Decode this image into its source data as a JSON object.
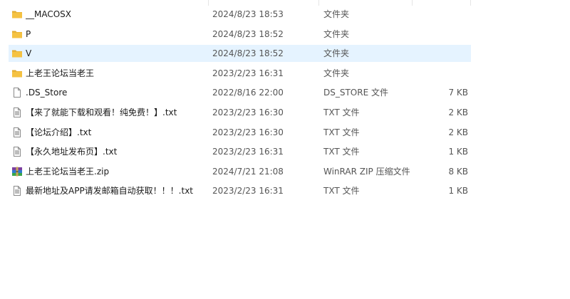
{
  "files": [
    {
      "name": "__MACOSX",
      "date": "2024/8/23 18:53",
      "type": "文件夹",
      "size": "",
      "icon": "folder-icon",
      "selected": false
    },
    {
      "name": "P",
      "date": "2024/8/23 18:52",
      "type": "文件夹",
      "size": "",
      "icon": "folder-icon",
      "selected": false
    },
    {
      "name": "V",
      "date": "2024/8/23 18:52",
      "type": "文件夹",
      "size": "",
      "icon": "folder-icon",
      "selected": true
    },
    {
      "name": "上老王论坛当老王",
      "date": "2023/2/23 16:31",
      "type": "文件夹",
      "size": "",
      "icon": "folder-icon",
      "selected": false
    },
    {
      "name": ".DS_Store",
      "date": "2022/8/16 22:00",
      "type": "DS_STORE 文件",
      "size": "7 KB",
      "icon": "blank-file-icon",
      "selected": false
    },
    {
      "name": "【来了就能下载和观看！纯免费！】.txt",
      "date": "2023/2/23 16:30",
      "type": "TXT 文件",
      "size": "2 KB",
      "icon": "text-file-icon",
      "selected": false
    },
    {
      "name": "【论坛介绍】.txt",
      "date": "2023/2/23 16:30",
      "type": "TXT 文件",
      "size": "2 KB",
      "icon": "text-file-icon",
      "selected": false
    },
    {
      "name": "【永久地址发布页】.txt",
      "date": "2023/2/23 16:31",
      "type": "TXT 文件",
      "size": "1 KB",
      "icon": "text-file-icon",
      "selected": false
    },
    {
      "name": "上老王论坛当老王.zip",
      "date": "2024/7/21 21:08",
      "type": "WinRAR ZIP 压缩文件",
      "size": "8 KB",
      "icon": "winrar-archive-icon",
      "selected": false
    },
    {
      "name": "最新地址及APP请发邮箱自动获取！！！.txt",
      "date": "2023/2/23 16:31",
      "type": "TXT 文件",
      "size": "1 KB",
      "icon": "text-file-icon",
      "selected": false
    }
  ],
  "colors": {
    "selection": "#e5f3ff",
    "folder": "#f5c242",
    "folder_dark": "#e0a82e"
  }
}
